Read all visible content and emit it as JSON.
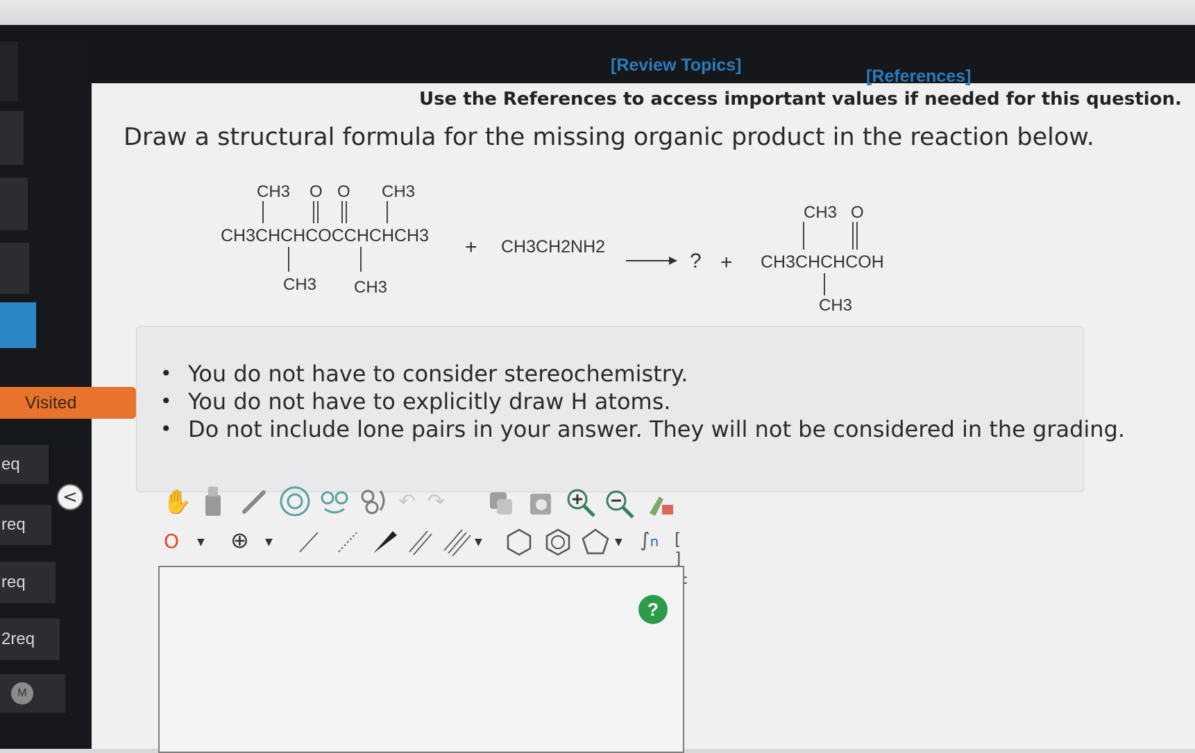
{
  "topbar": {
    "review_topics": "[Review Topics]",
    "references": "[References]"
  },
  "instructions": "Use the References to access important values if needed for this question.",
  "question": "Draw a structural formula for the missing organic product in the reaction below.",
  "reaction": {
    "reactant1": {
      "top_ch3_left": "CH3",
      "top_o1": "O",
      "top_o2": "O",
      "top_ch3_right": "CH3",
      "main": "CH3CHCHCOCCHCHCH3",
      "bottom_ch3_left": "CH3",
      "bottom_ch3_right": "CH3"
    },
    "plus1": "+",
    "reactant2": "CH3CH2NH2",
    "arrow": "⟶",
    "unknown": "?",
    "plus2": "+",
    "product2": {
      "top_ch3": "CH3",
      "top_o": "O",
      "main": "CH3CHCHCOH",
      "bottom_ch3": "CH3"
    }
  },
  "notes": [
    "You do not have to consider stereochemistry.",
    "You do not have to explicitly draw H atoms.",
    "Do not include lone pairs in your answer. They will not be considered in the grading."
  ],
  "sidebar": {
    "visited_label": "Visited",
    "items": [
      "eq",
      "req",
      "req",
      "2req",
      "M"
    ],
    "collapse": "<"
  },
  "toolbar2": {
    "atom_label": "O",
    "charge_label": "[ ]±",
    "sn_label": "n"
  },
  "canvas": {
    "help": "?"
  },
  "colors": {
    "link": "#2b7bbd",
    "visited": "#e8742c",
    "help": "#2e9b4a",
    "atom": "#e0452d"
  }
}
